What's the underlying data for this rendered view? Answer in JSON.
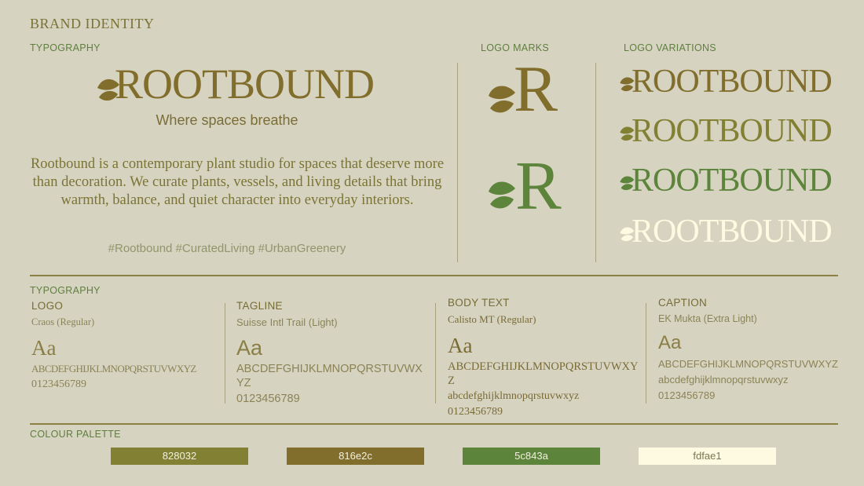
{
  "page_title": "BRAND IDENTITY",
  "typography_section": {
    "label": "TYPOGRAPHY",
    "wordmark": "ROOTBOUND",
    "tagline": "Where spaces breathe",
    "description": "Rootbound is a contemporary plant studio for spaces that deserve more than decoration. We curate plants, vessels, and living details that bring warmth, balance, and quiet character into everyday interiors.",
    "hashtags": "#Rootbound #CuratedLiving #UrbanGreenery"
  },
  "logo_marks": {
    "label": "LOGO MARKS",
    "marks": [
      {
        "letter": "R",
        "color": "#816e2c"
      },
      {
        "letter": "R",
        "color": "#5c843a"
      }
    ]
  },
  "logo_variations": {
    "label": "LOGO VARIATIONS",
    "items": [
      {
        "text": "ROOTBOUND",
        "color": "#816e2c"
      },
      {
        "text": "ROOTBOUND",
        "color": "#828032"
      },
      {
        "text": "ROOTBOUND",
        "color": "#5c843a"
      },
      {
        "text": "ROOTBOUND",
        "color": "#fdfae1"
      }
    ]
  },
  "type_specs": {
    "label": "TYPOGRAPHY",
    "columns": [
      {
        "title": "LOGO",
        "font": "Craos (Regular)",
        "sample": "Aa",
        "upper": "ABCDEFGHIJKLMNOPQRSTUVWXYZ",
        "lower": "",
        "digits": "0123456789"
      },
      {
        "title": "TAGLINE",
        "font": "Suisse Intl Trail (Light)",
        "sample": "Aa",
        "upper": "ABCDEFGHIJKLMNOPQRSTUVWXYZ",
        "lower": "",
        "digits": "0123456789"
      },
      {
        "title": "BODY TEXT",
        "font": "Calisto MT (Regular)",
        "sample": "Aa",
        "upper": "ABCDEFGHIJKLMNOPQRSTUVWXYZ",
        "lower": "abcdefghijklmnopqrstuvwxyz",
        "digits": "0123456789"
      },
      {
        "title": "CAPTION",
        "font": "EK Mukta (Extra Light)",
        "sample": "Aa",
        "upper": "ABCDEFGHIJKLMNOPQRSTUVWXYZ",
        "lower": "abcdefghijklmnopqrstuvwxyz",
        "digits": "0123456789"
      }
    ]
  },
  "palette": {
    "label": "COLOUR PALETTE",
    "swatches": [
      {
        "hex": "828032",
        "color": "#828032"
      },
      {
        "hex": "816e2c",
        "color": "#816e2c"
      },
      {
        "hex": "5c843a",
        "color": "#5c843a"
      },
      {
        "hex": "fdfae1",
        "color": "#fdfae1"
      }
    ]
  }
}
